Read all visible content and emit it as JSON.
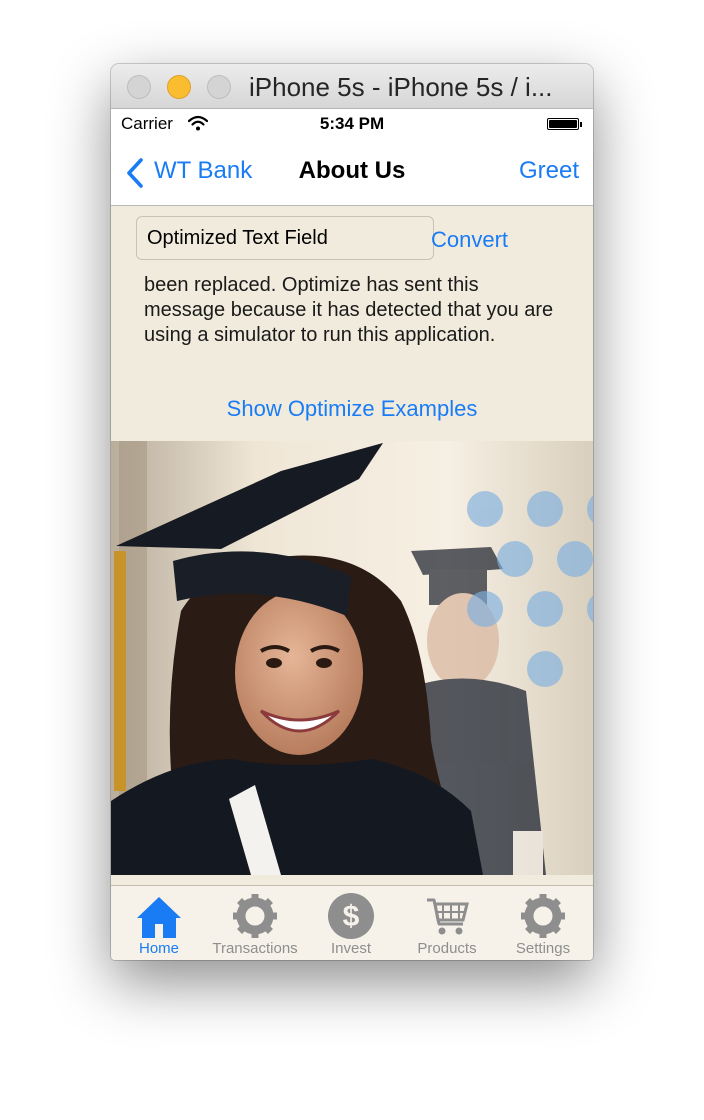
{
  "window": {
    "title": "iPhone 5s - iPhone 5s / i..."
  },
  "status_bar": {
    "carrier": "Carrier",
    "time": "5:34 PM"
  },
  "nav_bar": {
    "back_label": "WT Bank",
    "title": "About Us",
    "right_button": "Greet"
  },
  "content": {
    "text_field_value": "Optimized Text Field",
    "convert_button": "Convert",
    "message": "been replaced. Optimize has sent this message because it has detected that you are using a simulator to run this application.",
    "examples_link": "Show Optimize Examples"
  },
  "tab_bar": {
    "items": [
      {
        "label": "Home",
        "icon": "home-icon",
        "selected": true
      },
      {
        "label": "Transactions",
        "icon": "gear-icon",
        "selected": false
      },
      {
        "label": "Invest",
        "icon": "dollar-icon",
        "selected": false
      },
      {
        "label": "Products",
        "icon": "cart-icon",
        "selected": false
      },
      {
        "label": "Settings",
        "icon": "gear-icon",
        "selected": false
      }
    ]
  },
  "colors": {
    "accent": "#1a7cf5",
    "background": "#f1ebdd",
    "inactive_tab": "#8e8e8e"
  }
}
